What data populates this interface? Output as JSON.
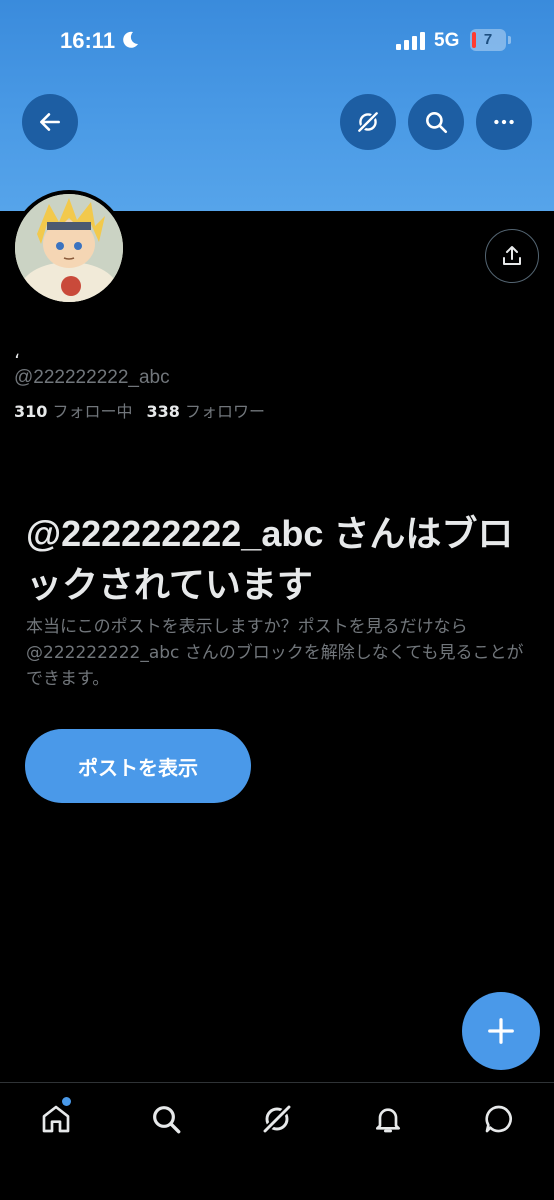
{
  "status_bar": {
    "time": "16:11",
    "network": "5G",
    "battery_level": "7"
  },
  "header": {
    "back_icon": "arrow-left-icon",
    "grok_icon": "grok-icon",
    "search_icon": "search-icon",
    "more_icon": "more-horizontal-icon",
    "banner_color": "#4a99e9"
  },
  "profile": {
    "display_name": "،",
    "handle": "@222222222_abc",
    "following_count": "310",
    "following_label": "フォロー中",
    "followers_count": "338",
    "followers_label": "フォロワー",
    "share_icon": "share-icon"
  },
  "blocked_notice": {
    "title": "@222222222_abc さんはブロックされています",
    "description": "本当にこのポストを表示しますか？ポストを見るだけなら @222222222_abc さんのブロックを解除しなくても見ることができます。",
    "button_label": "ポストを表示"
  },
  "fab": {
    "icon": "plus-icon"
  },
  "bottom_nav": {
    "items": [
      "home-icon",
      "search-icon",
      "grok-icon",
      "bell-icon",
      "message-icon"
    ],
    "accent": "#4a99e9"
  }
}
